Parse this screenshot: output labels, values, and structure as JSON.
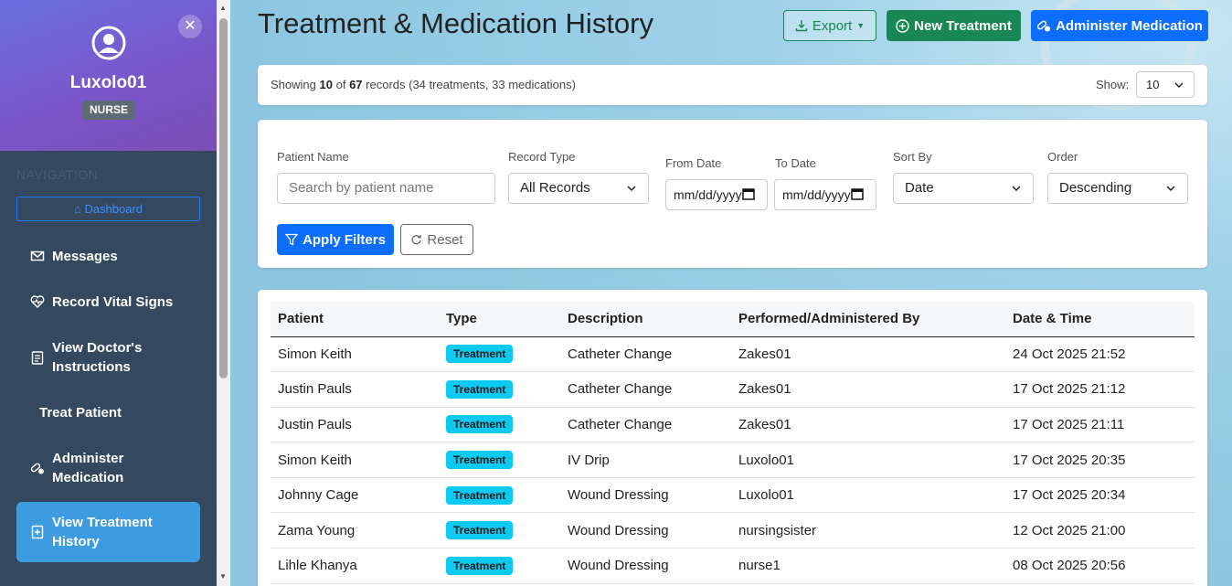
{
  "sidebar": {
    "username": "Luxolo01",
    "role": "NURSE",
    "nav_heading": "NAVIGATION",
    "dashboard_label": "Dashboard",
    "items": [
      {
        "label": "Messages",
        "icon": "envelope-icon"
      },
      {
        "label": "Record Vital Signs",
        "icon": "heart-pulse-icon"
      },
      {
        "label": "View Doctor's Instructions",
        "icon": "clipboard-icon"
      },
      {
        "label": "Treat Patient",
        "icon": ""
      },
      {
        "label": "Administer Medication",
        "icon": "capsule-icon"
      },
      {
        "label": "View Treatment History",
        "icon": "file-medical-icon"
      }
    ]
  },
  "header": {
    "title": "Treatment & Medication History",
    "export_label": "Export",
    "new_treatment_label": "New Treatment",
    "administer_label": "Administer Medication"
  },
  "summary": {
    "prefix": "Showing",
    "shown": "10",
    "of": "of",
    "total": "67",
    "suffix": "records (34 treatments, 33 medications)",
    "show_label": "Show:",
    "show_value": "10"
  },
  "filters": {
    "patient_label": "Patient Name",
    "patient_placeholder": "Search by patient name",
    "type_label": "Record Type",
    "type_value": "All Records",
    "from_label": "From Date",
    "from_value": "mm/dd/yyyy",
    "to_label": "To Date",
    "to_value": "mm/dd/yyyy",
    "sort_label": "Sort By",
    "sort_value": "Date",
    "order_label": "Order",
    "order_value": "Descending",
    "apply_label": "Apply Filters",
    "reset_label": "Reset"
  },
  "table": {
    "headers": [
      "Patient",
      "Type",
      "Description",
      "Performed/Administered By",
      "Date & Time"
    ],
    "rows": [
      {
        "patient": "Simon Keith",
        "type": "Treatment",
        "description": "Catheter Change",
        "by": "Zakes01",
        "datetime": "24 Oct 2025 21:52"
      },
      {
        "patient": "Justin Pauls",
        "type": "Treatment",
        "description": "Catheter Change",
        "by": "Zakes01",
        "datetime": "17 Oct 2025 21:12"
      },
      {
        "patient": "Justin Pauls",
        "type": "Treatment",
        "description": "Catheter Change",
        "by": "Zakes01",
        "datetime": "17 Oct 2025 21:11"
      },
      {
        "patient": "Simon Keith",
        "type": "Treatment",
        "description": "IV Drip",
        "by": "Luxolo01",
        "datetime": "17 Oct 2025 20:35"
      },
      {
        "patient": "Johnny Cage",
        "type": "Treatment",
        "description": "Wound Dressing",
        "by": "Luxolo01",
        "datetime": "17 Oct 2025 20:34"
      },
      {
        "patient": "Zama Young",
        "type": "Treatment",
        "description": "Wound Dressing",
        "by": "nursingsister",
        "datetime": "12 Oct 2025 21:00"
      },
      {
        "patient": "Lihle Khanya",
        "type": "Treatment",
        "description": "Wound Dressing",
        "by": "nurse1",
        "datetime": "08 Oct 2025 20:56"
      }
    ]
  }
}
